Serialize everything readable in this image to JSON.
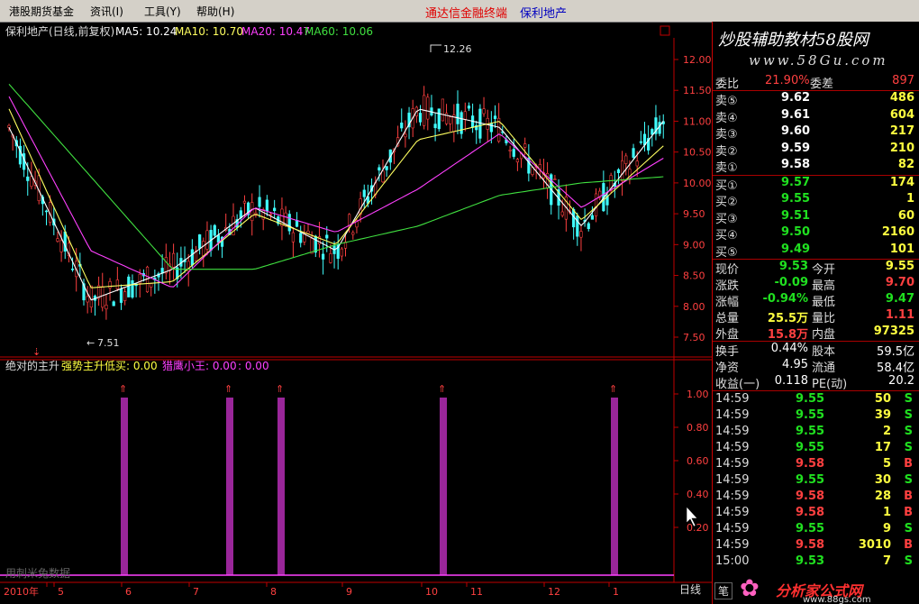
{
  "menu": {
    "items": [
      "港股期货基金",
      "资讯(I)",
      "工具(Y)",
      "帮助(H)"
    ],
    "center_link": "通达信金融终端",
    "center_stock": "保利地产"
  },
  "chart": {
    "title": "保利地产(日线,前复权)",
    "ma5": "MA5: 10.24",
    "ma10": "MA10: 10.70",
    "ma20": "MA20: 10.47",
    "ma60": "MA60: 10.06",
    "high_label": "12.26",
    "low_label": "7.51",
    "price_ticks": [
      "12.00",
      "11.50",
      "11.00",
      "10.50",
      "10.00",
      "9.50",
      "9.00",
      "8.50",
      "8.00",
      "7.50"
    ],
    "indicator_name": "绝对的主升",
    "indicator_line1": "强势主升低买: 0.00",
    "indicator_line2": "猎鹰小王: 0.00",
    "indicator_value3": ": 0.00",
    "ind_ticks": [
      "1.00",
      "0.80",
      "0.60",
      "0.40",
      "0.20"
    ],
    "watermark": "用刺米兔数据",
    "x_labels": [
      "2010年",
      "5",
      "6",
      "7",
      "8",
      "9",
      "10",
      "11",
      "12",
      "1"
    ],
    "period": "日线",
    "colors": {
      "ma5": "#ffffff",
      "ma10": "#ffff60",
      "ma20": "#ff40ff",
      "ma60": "#40e040",
      "up": "#ff4040",
      "down": "#40ffff",
      "signal": "#ff40ff"
    }
  },
  "chart_data": [
    {
      "type": "line",
      "title": "保利地产(日线,前复权)",
      "ylim": [
        7.3,
        12.3
      ],
      "x": [
        "5",
        "6",
        "7",
        "8",
        "9",
        "10",
        "11",
        "12",
        "1"
      ],
      "series": [
        {
          "name": "MA5",
          "values": [
            10.9,
            8.1,
            8.6,
            9.6,
            8.9,
            11.2,
            10.9,
            9.3,
            11.0
          ]
        },
        {
          "name": "MA10",
          "values": [
            11.2,
            8.3,
            8.4,
            9.5,
            9.0,
            10.7,
            11.0,
            9.4,
            10.6
          ]
        },
        {
          "name": "MA20",
          "values": [
            11.4,
            8.9,
            8.3,
            9.6,
            9.2,
            9.9,
            10.8,
            9.6,
            10.4
          ]
        },
        {
          "name": "MA60",
          "values": [
            11.6,
            10.1,
            8.6,
            8.6,
            9.0,
            9.3,
            9.8,
            10.0,
            10.1
          ]
        }
      ],
      "annotations": [
        {
          "label": "12.26",
          "value": 12.26
        },
        {
          "label": "7.51",
          "value": 7.51
        }
      ]
    },
    {
      "type": "bar",
      "title": "绝对的主升",
      "ylim": [
        0,
        1.2
      ],
      "series": [
        {
          "name": "强势主升低买",
          "values": [
            1,
            1,
            1,
            1,
            1
          ]
        }
      ]
    }
  ],
  "panel": {
    "brand_text1": "炒股辅助教材58股网",
    "brand_text2": "www.58Gu.com",
    "weibi_label": "委比",
    "weibi_value": "21.90%",
    "weicha_label": "委差",
    "weicha_value": "897",
    "sell": [
      {
        "label": "卖⑤",
        "price": "9.62",
        "vol": "486"
      },
      {
        "label": "卖④",
        "price": "9.61",
        "vol": "604"
      },
      {
        "label": "卖③",
        "price": "9.60",
        "vol": "217"
      },
      {
        "label": "卖②",
        "price": "9.59",
        "vol": "210"
      },
      {
        "label": "卖①",
        "price": "9.58",
        "vol": "82"
      }
    ],
    "buy": [
      {
        "label": "买①",
        "price": "9.57",
        "vol": "174"
      },
      {
        "label": "买②",
        "price": "9.55",
        "vol": "1"
      },
      {
        "label": "买③",
        "price": "9.51",
        "vol": "60"
      },
      {
        "label": "买④",
        "price": "9.50",
        "vol": "2160"
      },
      {
        "label": "买⑤",
        "price": "9.49",
        "vol": "101"
      }
    ],
    "quote": [
      {
        "l1": "现价",
        "v1": "9.53",
        "l2": "今开",
        "v2": "9.55"
      },
      {
        "l1": "涨跌",
        "v1": "-0.09",
        "l2": "最高",
        "v2": "9.70"
      },
      {
        "l1": "涨幅",
        "v1": "-0.94%",
        "l2": "最低",
        "v2": "9.47"
      },
      {
        "l1": "总量",
        "v1": "25.5万",
        "l2": "量比",
        "v2": "1.11"
      },
      {
        "l1": "外盘",
        "v1": "15.8万",
        "l2": "内盘",
        "v2": "97325"
      }
    ],
    "stats": [
      {
        "l1": "换手",
        "v1": "0.44%",
        "l2": "股本",
        "v2": "59.5亿"
      },
      {
        "l1": "净资",
        "v1": "4.95",
        "l2": "流通",
        "v2": "58.4亿"
      },
      {
        "l1": "收益(一)",
        "v1": "0.118",
        "l2": "PE(动)",
        "v2": "20.2"
      }
    ],
    "trades": [
      {
        "t": "14:59",
        "p": "9.55",
        "v": "50",
        "s": "S"
      },
      {
        "t": "14:59",
        "p": "9.55",
        "v": "39",
        "s": "S"
      },
      {
        "t": "14:59",
        "p": "9.55",
        "v": "2",
        "s": "S"
      },
      {
        "t": "14:59",
        "p": "9.55",
        "v": "17",
        "s": "S"
      },
      {
        "t": "14:59",
        "p": "9.58",
        "v": "5",
        "s": "B"
      },
      {
        "t": "14:59",
        "p": "9.55",
        "v": "30",
        "s": "S"
      },
      {
        "t": "14:59",
        "p": "9.58",
        "v": "28",
        "s": "B"
      },
      {
        "t": "14:59",
        "p": "9.58",
        "v": "1",
        "s": "B"
      },
      {
        "t": "14:59",
        "p": "9.55",
        "v": "9",
        "s": "S"
      },
      {
        "t": "14:59",
        "p": "9.58",
        "v": "3010",
        "s": "B"
      },
      {
        "t": "15:00",
        "p": "9.53",
        "v": "7",
        "s": "S"
      }
    ],
    "bottom_tab": "笔",
    "logo_text": "分析家公式网",
    "logo_url": "www.88gs.com"
  }
}
